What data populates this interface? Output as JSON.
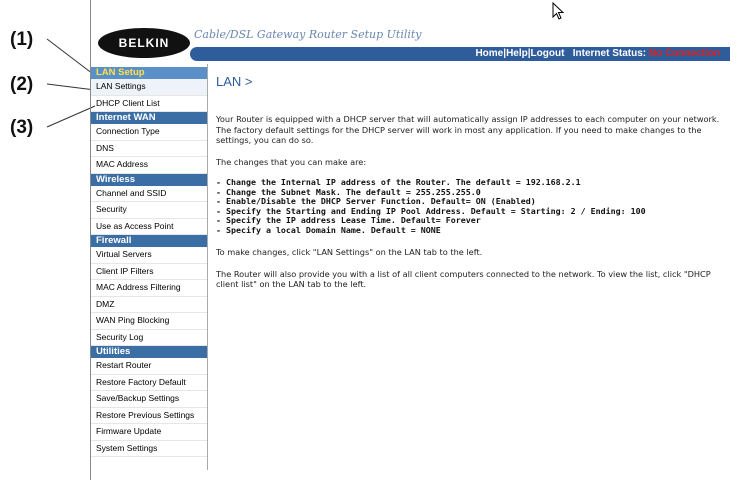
{
  "callouts": [
    "(1)",
    "(2)",
    "(3)"
  ],
  "header": {
    "logo": "BELKIN",
    "utility_title": "Cable/DSL Gateway Router Setup Utility",
    "links": [
      "Home",
      "Help",
      "Logout"
    ],
    "status_label": "Internet Status:",
    "status_value": "No Connection",
    "separator": "|"
  },
  "sidebar": {
    "sections": [
      {
        "title": "LAN Setup",
        "active": true,
        "items": [
          "LAN Settings",
          "DHCP Client List"
        ]
      },
      {
        "title": "Internet WAN",
        "items": [
          "Connection Type",
          "DNS",
          "MAC Address"
        ]
      },
      {
        "title": "Wireless",
        "items": [
          "Channel and SSID",
          "Security",
          "Use as Access Point"
        ]
      },
      {
        "title": "Firewall",
        "items": [
          "Virtual Servers",
          "Client IP Filters",
          "MAC Address Filtering",
          "DMZ",
          "WAN Ping Blocking",
          "Security Log"
        ]
      },
      {
        "title": "Utilities",
        "items": [
          "Restart Router",
          "Restore Factory Default",
          "Save/Backup Settings",
          "Restore Previous Settings",
          "Firmware Update",
          "System Settings"
        ]
      }
    ]
  },
  "main": {
    "title": "LAN >",
    "intro": "Your Router is equipped with a DHCP server that will automatically assign IP addresses to each computer on your network. The factory default settings for the DHCP server will work in most any application. If you need to make changes to the settings, you can do so.",
    "changes_heading": "The changes that you can make are:",
    "changes": [
      "- Change the Internal IP address of the Router. The default = 192.168.2.1",
      "- Change the Subnet Mask. The default = 255.255.255.0",
      "- Enable/Disable the DHCP Server Function. Default= ON (Enabled)",
      "- Specify the Starting and Ending IP Pool Address. Default = Starting: 2 / Ending: 100",
      "- Specify the IP address Lease Time. Default= Forever",
      "- Specify a local Domain Name. Default = NONE"
    ],
    "instructions": "To make changes, click \"LAN Settings\" on the LAN tab to the left.",
    "client_list_note": "The Router will also provide you with a list of all client computers connected to the network. To view the list, click \"DHCP client list\" on the LAN tab to the left."
  },
  "colors": {
    "nav_blue": "#2f5d9c",
    "section_blue": "#3a6ea5",
    "status_red": "#e02020",
    "active_section_text": "#ffe14a"
  }
}
